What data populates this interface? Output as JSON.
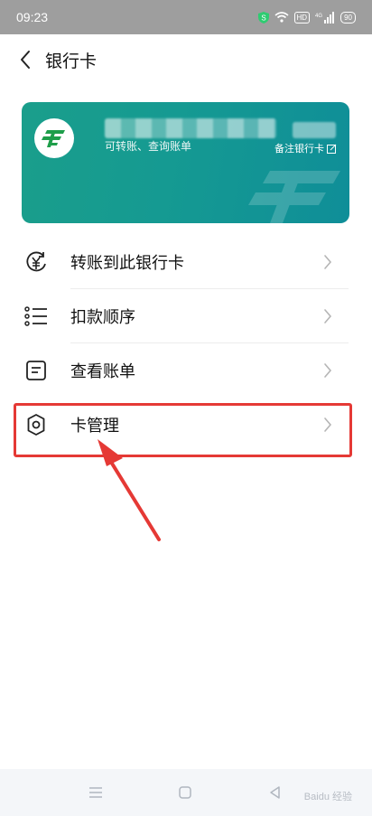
{
  "status_bar": {
    "time": "09:23",
    "network": "4G",
    "sim_badge": "HD",
    "battery": "90"
  },
  "header": {
    "title": "银行卡"
  },
  "card": {
    "subtitle": "可转账、查询账单",
    "remark_label": "备注银行卡",
    "colors": {
      "start": "#1a9e8b",
      "end": "#0f8e98"
    }
  },
  "menu": {
    "items": [
      {
        "label": "转账到此银行卡",
        "icon": "yuan-transfer-icon"
      },
      {
        "label": "扣款顺序",
        "icon": "list-icon"
      },
      {
        "label": "查看账单",
        "icon": "bill-icon"
      },
      {
        "label": "卡管理",
        "icon": "gear-icon"
      }
    ]
  },
  "annotation": {
    "highlight_color": "#e53935"
  },
  "watermark": {
    "text": "Baidu 经验"
  }
}
